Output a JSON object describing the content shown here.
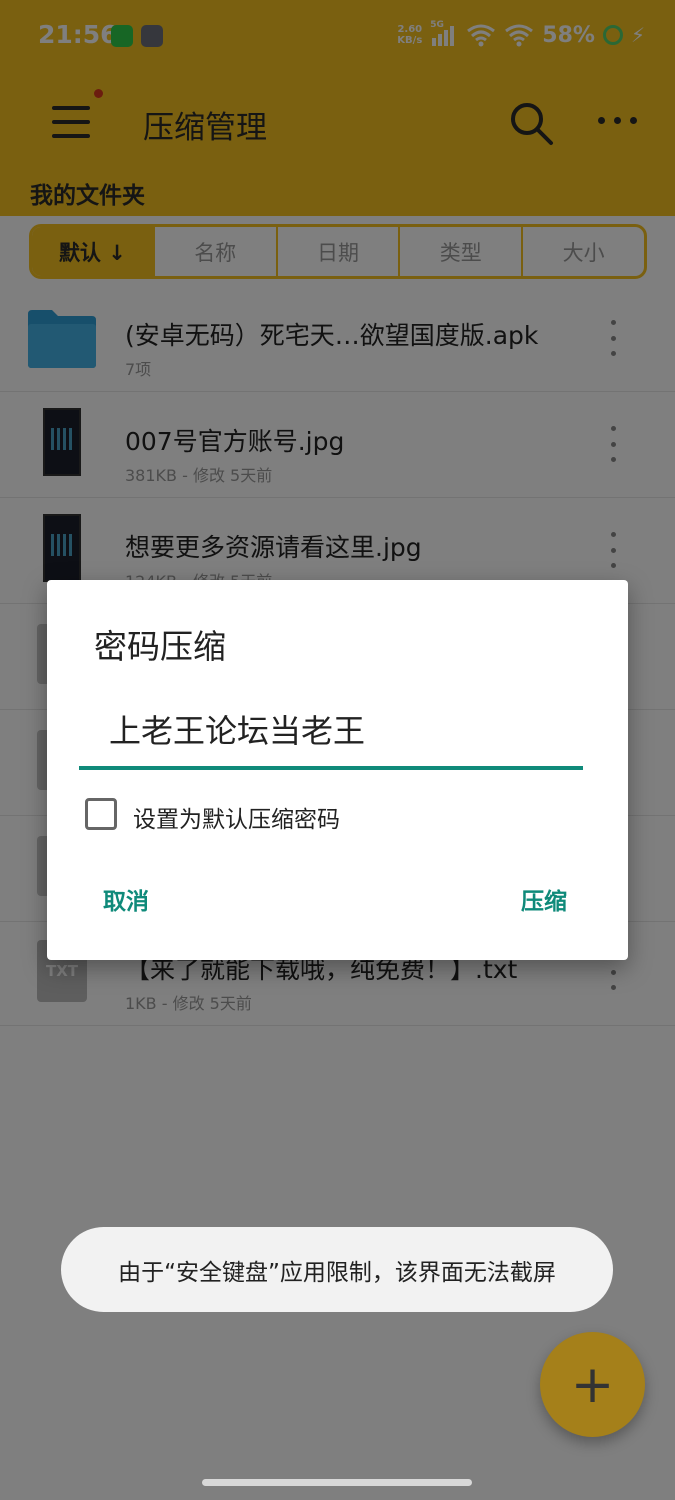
{
  "status_bar": {
    "time": "21:56",
    "net_speed_value": "2.60",
    "net_speed_unit": "KB/s",
    "network_type": "5G",
    "battery": "58%"
  },
  "app_bar": {
    "title": "压缩管理",
    "path_title": "我的文件夹"
  },
  "sort_tabs": [
    "默认 ↓",
    "名称",
    "日期",
    "类型",
    "大小"
  ],
  "files": [
    {
      "name": "(安卓无码）死宅天…欲望国度版.apk",
      "meta": "7项",
      "icon": "folder-icon"
    },
    {
      "name": "007号官方账号.jpg",
      "meta": "381KB - 修改 5天前",
      "icon": "image-thumbnail-icon"
    },
    {
      "name": "想要更多资源请看这里.jpg",
      "meta": "124KB - 修改 5天前",
      "icon": "image-thumbnail-icon"
    },
    {
      "name": "",
      "meta": "",
      "icon": "file-icon"
    },
    {
      "name": "",
      "meta": "",
      "icon": "file-icon"
    },
    {
      "name": "",
      "meta": "",
      "icon": "file-icon"
    },
    {
      "name": "【来了就能下载哦，纯免费！】.txt",
      "meta": "1KB - 修改 5天前",
      "icon": "txt-file-icon",
      "icon_text": "TXT"
    }
  ],
  "dialog": {
    "title": "密码压缩",
    "password_value": "上老王论坛当老王",
    "checkbox_label": "设置为默认压缩密码",
    "checkbox_checked": false,
    "cancel_label": "取消",
    "confirm_label": "压缩"
  },
  "toast": {
    "message": "由于“安全键盘”应用限制，该界面无法截屏"
  },
  "fab": {
    "symbol": "+"
  },
  "colors": {
    "accent": "#f4c020",
    "dialog_accent": "#0f8a7a"
  }
}
